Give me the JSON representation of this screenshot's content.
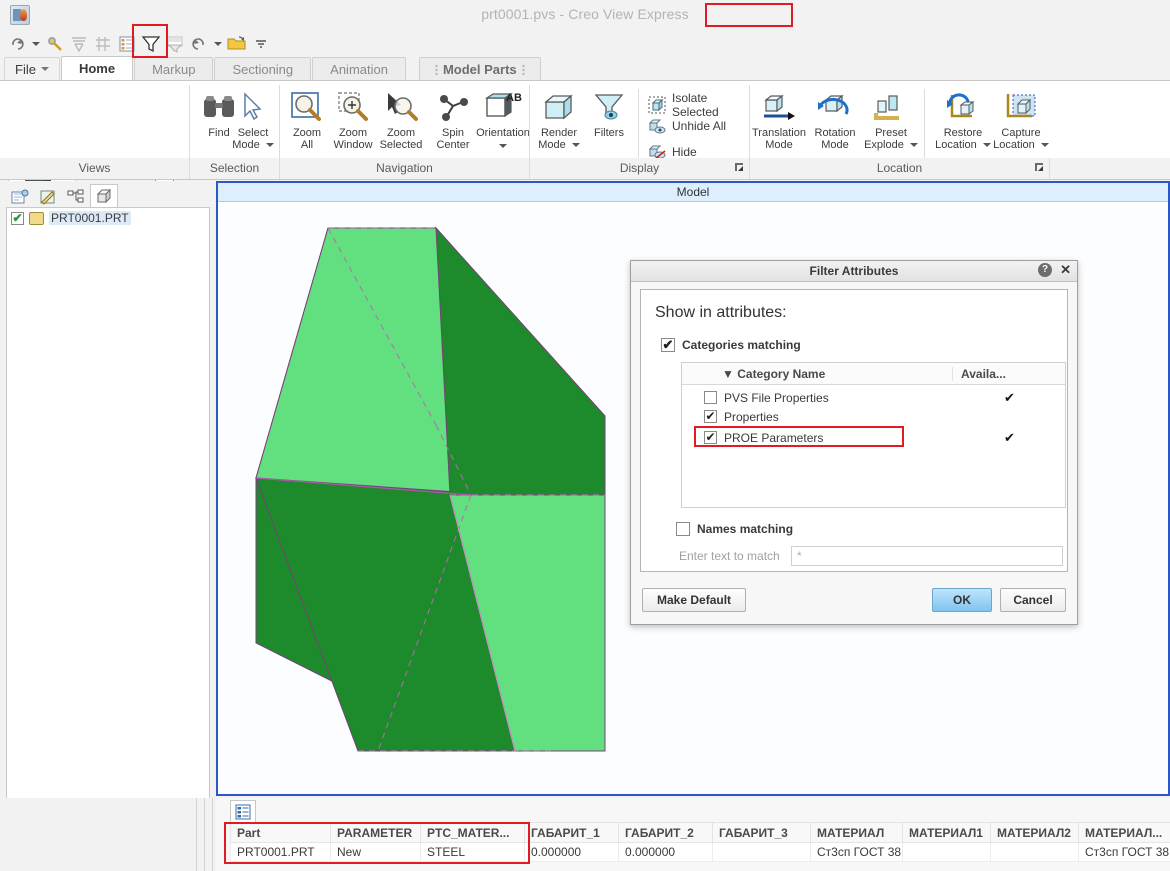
{
  "window": {
    "title_file": "prt0001.pvs",
    "title_sep": " - ",
    "title_app": "Creo View Express",
    "app_icon": "creo-view-app-icon"
  },
  "quick_access": {
    "items": [
      {
        "name": "redo-icon",
        "label": "Redo"
      },
      {
        "name": "quick-access-dropdown-icon",
        "label": ""
      },
      {
        "name": "highlight-icon",
        "label": "Highlight"
      },
      {
        "name": "filter-tree-icon",
        "label": "Filter Tree"
      },
      {
        "name": "grid-snap-icon",
        "label": "Grid"
      },
      {
        "name": "attributes-list-icon",
        "label": "Attributes"
      },
      {
        "name": "filter-attributes-icon",
        "label": "Filter Attributes"
      },
      {
        "name": "table-filter-icon",
        "label": "Table Filter"
      },
      {
        "name": "undo-icon",
        "label": "Undo"
      },
      {
        "name": "undo-dropdown-icon",
        "label": ""
      },
      {
        "name": "open-file-icon",
        "label": "Open"
      },
      {
        "name": "customize-toolbar-icon",
        "label": "Customize"
      }
    ]
  },
  "tabs": [
    {
      "label": "File",
      "active": false,
      "is_menu": true
    },
    {
      "label": "Home",
      "active": true,
      "is_menu": false
    },
    {
      "label": "Markup",
      "active": false,
      "is_menu": false
    },
    {
      "label": "Sectioning",
      "active": false,
      "is_menu": false
    },
    {
      "label": "Animation",
      "active": false,
      "is_menu": false
    },
    {
      "label": "Model Parts",
      "active": false,
      "is_menu": false,
      "floating": true
    }
  ],
  "ribbon": {
    "groups": [
      {
        "label": "Views"
      },
      {
        "label": "Selection"
      },
      {
        "label": "Navigation"
      },
      {
        "label": "Display",
        "has_dialog_launcher": true
      },
      {
        "label": "Location",
        "has_dialog_launcher": true
      }
    ],
    "selection_buttons": [
      {
        "label_line1": "Find",
        "label_line2": "",
        "icon": "binoculars-icon"
      },
      {
        "label_line1": "Select",
        "label_line2": "Mode",
        "icon": "cursor-arrow-icon",
        "has_caret": true
      }
    ],
    "navigation_buttons": [
      {
        "label_line1": "Zoom",
        "label_line2": "All",
        "icon": "zoom-all-icon"
      },
      {
        "label_line1": "Zoom",
        "label_line2": "Window",
        "icon": "zoom-window-icon"
      },
      {
        "label_line1": "Zoom",
        "label_line2": "Selected",
        "icon": "zoom-selected-icon"
      },
      {
        "label_line1": "Spin",
        "label_line2": "Center",
        "icon": "spin-center-icon"
      },
      {
        "label_line1": "Orientation",
        "label_line2": "",
        "icon": "orientation-icon",
        "has_caret": true
      }
    ],
    "display_buttons": [
      {
        "label_line1": "Render",
        "label_line2": "Mode",
        "icon": "render-mode-icon",
        "has_caret": true
      },
      {
        "label_line1": "Filters",
        "label_line2": "",
        "icon": "filters-funnel-icon"
      }
    ],
    "display_small_buttons": [
      {
        "label": "Isolate Selected",
        "icon": "isolate-selected-icon"
      },
      {
        "label": "Unhide All",
        "icon": "unhide-all-icon"
      },
      {
        "label": "Hide",
        "icon": "hide-icon"
      }
    ],
    "location_buttons": [
      {
        "label_line1": "Translation",
        "label_line2": "Mode",
        "icon": "translation-mode-icon"
      },
      {
        "label_line1": "Rotation",
        "label_line2": "Mode",
        "icon": "rotation-mode-icon"
      },
      {
        "label_line1": "Preset",
        "label_line2": "Explode",
        "icon": "preset-explode-icon",
        "has_caret": true
      },
      {
        "label_line1": "Restore",
        "label_line2": "Location",
        "icon": "restore-location-icon",
        "has_caret": true
      },
      {
        "label_line1": "Capture",
        "label_line2": "Location",
        "icon": "capture-location-icon",
        "has_caret": true
      }
    ]
  },
  "tree_panel": {
    "tabs": [
      {
        "name": "structure-tab-icon",
        "active": false
      },
      {
        "name": "markup-tab-icon",
        "active": false
      },
      {
        "name": "hierarchy-tab-icon",
        "active": false
      },
      {
        "name": "model-tree-tab-icon",
        "active": true
      }
    ],
    "nodes": [
      {
        "label": "PRT0001.PRT",
        "checked": true,
        "selected": true
      }
    ]
  },
  "viewport": {
    "title": "Model",
    "model_colors": {
      "light": "#62e07f",
      "dark": "#1d8a2c",
      "edge": "#b46bb4"
    }
  },
  "dialog": {
    "title": "Filter Attributes",
    "help_glyph": "?",
    "close_glyph": "✕",
    "heading": "Show in attributes:",
    "categories_matching": {
      "label": "Categories matching",
      "checked": true
    },
    "table": {
      "columns": [
        "Category Name",
        "Availa..."
      ],
      "sort_indicator": "▼",
      "rows": [
        {
          "name": "PVS File Properties",
          "checked": false,
          "available": "✔",
          "highlighted": false
        },
        {
          "name": "Properties",
          "checked": true,
          "available": "",
          "highlighted": false
        },
        {
          "name": "PROE Parameters",
          "checked": true,
          "available": "✔",
          "highlighted": true
        }
      ]
    },
    "names_matching": {
      "label": "Names matching",
      "checked": false
    },
    "match_field": {
      "label": "Enter text to match",
      "value": "*"
    },
    "buttons": {
      "make_default": "Make Default",
      "ok": "OK",
      "cancel": "Cancel"
    }
  },
  "attributes_table": {
    "tab_icon": "attributes-table-tab-icon",
    "columns": [
      "Part",
      "PARAMETER",
      "PTC_MATER...",
      "ГАБАРИТ_1",
      "ГАБАРИТ_2",
      "ГАБАРИТ_3",
      "МАТЕРИАЛ",
      "МАТЕРИАЛ1",
      "МАТЕРИАЛ2",
      "МАТЕРИАЛ..."
    ],
    "rows": [
      [
        "PRT0001.PRT",
        "New",
        "STEEL",
        "0.000000",
        "0.000000",
        "",
        "Ст3сп ГОСТ 38...",
        "",
        "",
        "Ст3сп ГОСТ 38..."
      ]
    ]
  },
  "highlights": {
    "color": "#e01b24",
    "regions": [
      "title-filename",
      "quick-access-filter-attributes",
      "dialog-proe-parameters-row",
      "table-first-three-columns"
    ]
  }
}
